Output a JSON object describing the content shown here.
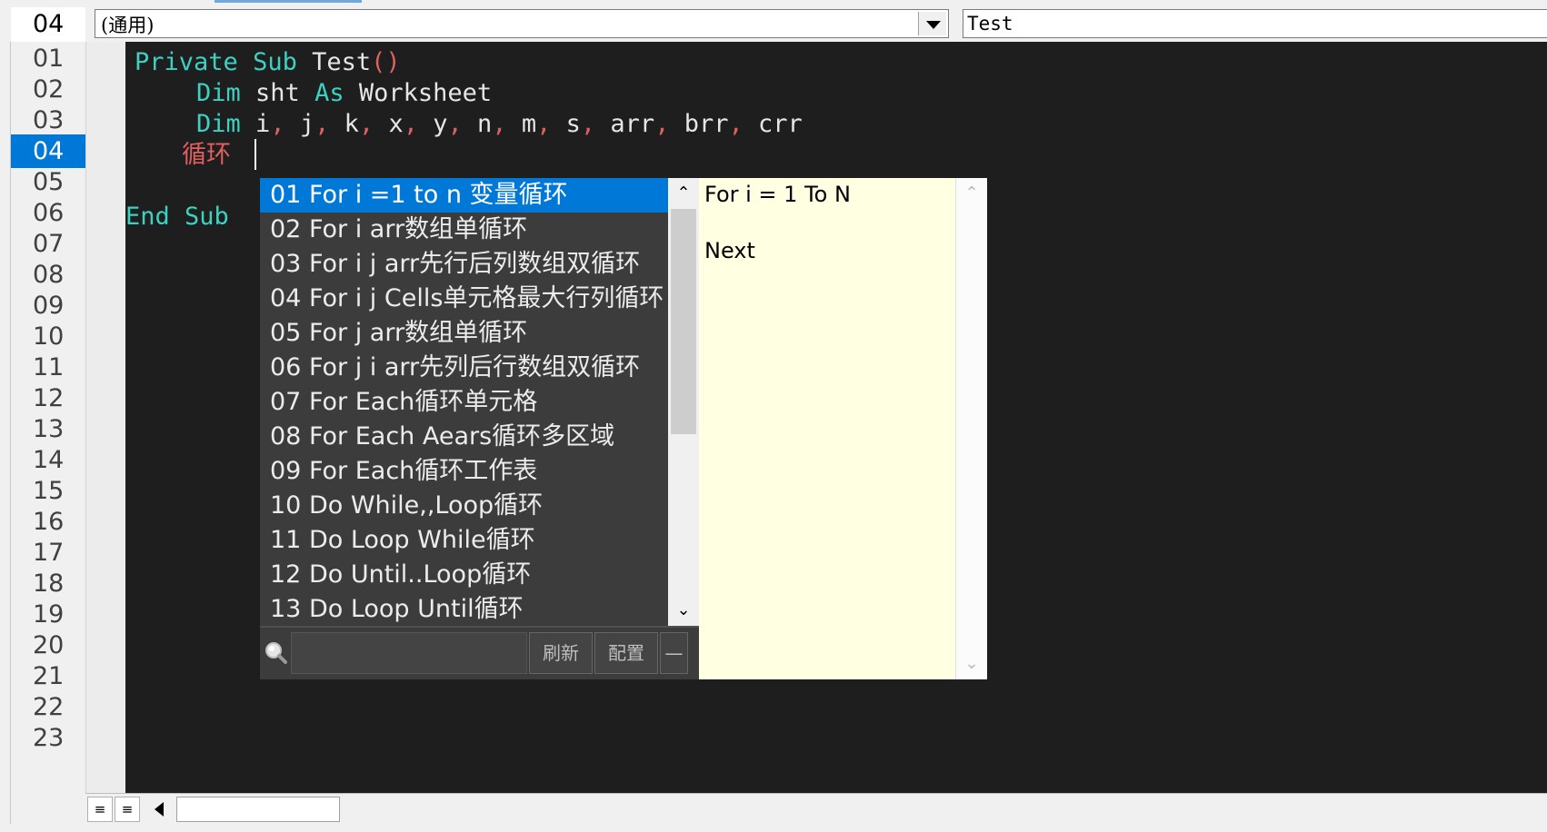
{
  "header": {
    "line_indicator": "04",
    "object_combo_value": "(通用)",
    "procedure_combo_value": "Test"
  },
  "gutter": {
    "line_numbers": [
      "01",
      "02",
      "03",
      "04",
      "05",
      "06",
      "07",
      "08",
      "09",
      "10",
      "11",
      "12",
      "13",
      "14",
      "15",
      "16",
      "17",
      "18",
      "19",
      "20",
      "21",
      "22",
      "23"
    ],
    "active_line": "04"
  },
  "code": {
    "line1": {
      "kw1": "Private",
      "kw2": "Sub",
      "name": "Test",
      "parens": "()"
    },
    "line2": {
      "kw1": "Dim",
      "var": "sht",
      "kw2": "As",
      "type": "Worksheet"
    },
    "line3": {
      "kw": "Dim",
      "vars": [
        "i",
        "j",
        "k",
        "x",
        "y",
        "n",
        "m",
        "s",
        "arr",
        "brr",
        "crr"
      ],
      "sep": ","
    },
    "line4": {
      "typed": "循环"
    },
    "line6": {
      "kw1": "End",
      "kw2": "Sub"
    }
  },
  "autocomplete": {
    "items": [
      "01 For i =1 to n 变量循环",
      "02 For i arr数组单循环",
      "03 For i j arr先行后列数组双循环",
      "04 For i j Cells单元格最大行列循环",
      "05 For j arr数组单循环",
      "06 For j i arr先列后行数组双循环",
      "07 For Each循环单元格",
      "08 For Each Aears循环多区域",
      "09 For Each循环工作表",
      "10 Do While,,Loop循环",
      "11 Do Loop While循环",
      "12 Do Until..Loop循环",
      "13 Do Loop Until循环"
    ],
    "selected_index": 0,
    "search_value": "",
    "refresh_label": "刷新",
    "config_label": "配置",
    "collapse_label": "—"
  },
  "preview": {
    "lines": [
      "For i = 1 To N",
      "",
      "Next"
    ]
  },
  "icons": {
    "search": "search-icon",
    "scroll_up": "chevron-up-icon",
    "scroll_down": "chevron-down-icon",
    "scroll_left": "arrow-left-icon"
  },
  "colors": {
    "editor_bg": "#1e1e1e",
    "keyword": "#3dd1c2",
    "highlight": "#0078d7",
    "popup_bg": "#3c3c3c",
    "preview_bg": "#ffffe1"
  }
}
